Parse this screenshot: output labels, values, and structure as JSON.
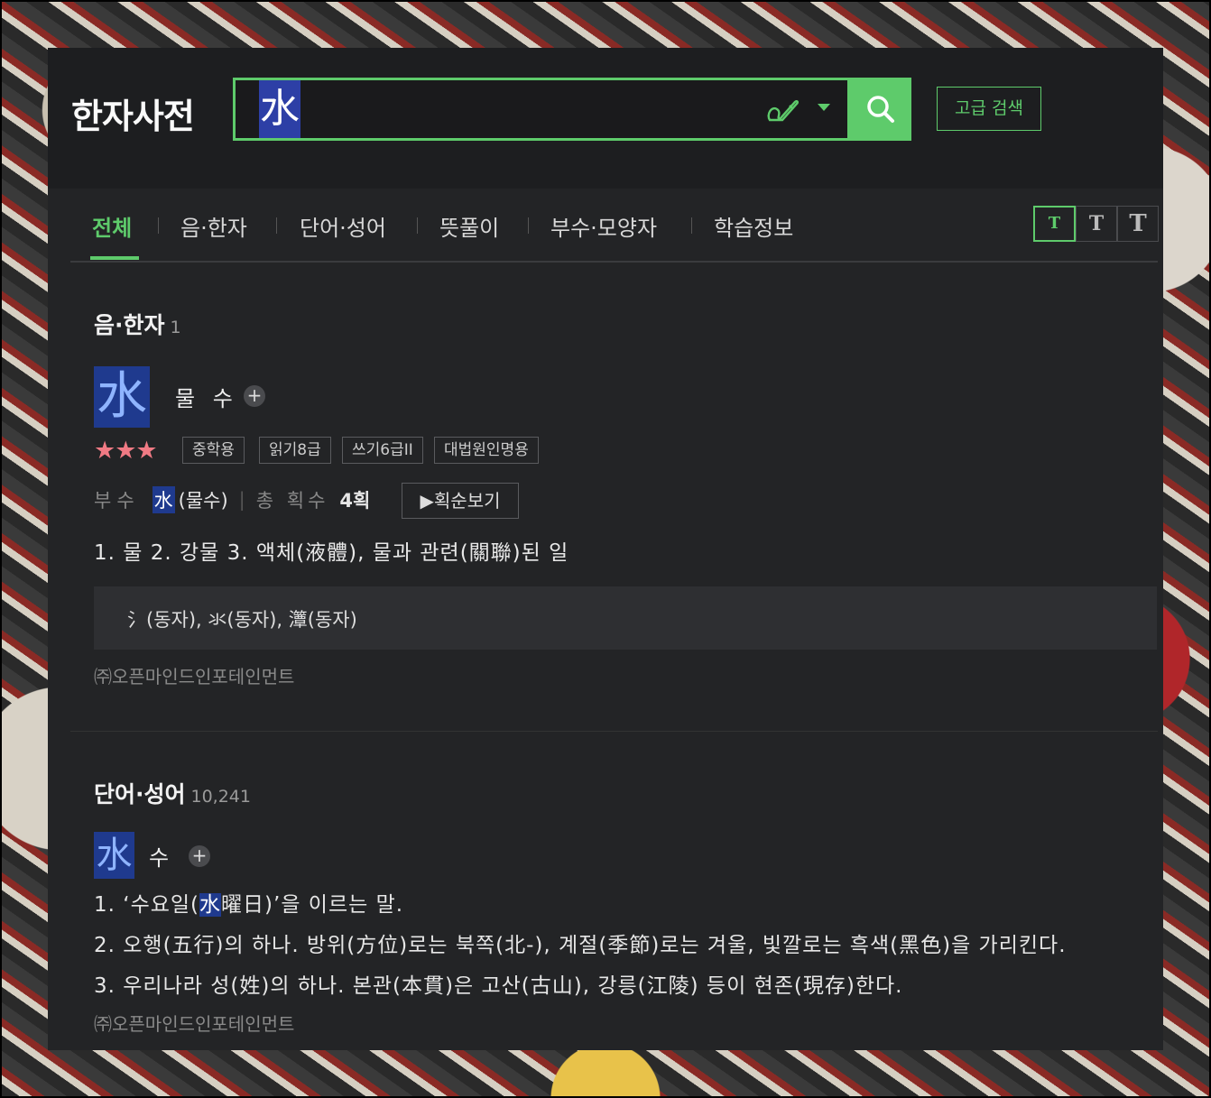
{
  "header": {
    "logo": "한자사전",
    "search_value": "水",
    "advanced_search_label": "고급 검색"
  },
  "tabs": [
    {
      "label": "전체",
      "active": true
    },
    {
      "label": "음·한자"
    },
    {
      "label": "단어·성어"
    },
    {
      "label": "뜻풀이"
    },
    {
      "label": "부수·모양자"
    },
    {
      "label": "학습정보"
    }
  ],
  "font_size_buttons": [
    "T",
    "T",
    "T"
  ],
  "section_hanja": {
    "title": "음·한자",
    "count": "1",
    "character": "水",
    "reading": "물 수",
    "stars": "★★★",
    "badges": [
      "중학용",
      "읽기8급",
      "쓰기6급II",
      "대법원인명용"
    ],
    "radical_label": "부수",
    "radical_char": "水",
    "radical_name": "(물수)",
    "strokes_label": "총 획수",
    "strokes_value": "4획",
    "stroke_order_label": "획순보기",
    "meaning": "1. 물  2. 강물  3. 액체(液體), 물과 관련(關聯)된 일",
    "variants": "氵(동자), 氺(동자), 㶘(동자)",
    "source": "㈜오픈마인드인포테인먼트"
  },
  "section_words": {
    "title": "단어·성어",
    "count": "10,241",
    "character": "水",
    "reading": "수",
    "def1_pre": "1. ‘수요일(",
    "def1_hl": "水",
    "def1_post": "曜日)’을 이르는 말.",
    "def2": "2. 오행(五行)의 하나. 방위(方位)로는 북쪽(北-), 계절(季節)로는 겨울, 빛깔로는 흑색(黑色)을 가리킨다.",
    "def3": "3. 우리나라 성(姓)의 하나. 본관(本貫)은 고산(古山), 강릉(江陵) 등이 현존(現存)한다.",
    "source": "㈜오픈마인드인포테인먼트"
  },
  "colors": {
    "accent": "#5ecb6b",
    "highlight": "#1f3a8e",
    "stars": "#f07a84"
  }
}
